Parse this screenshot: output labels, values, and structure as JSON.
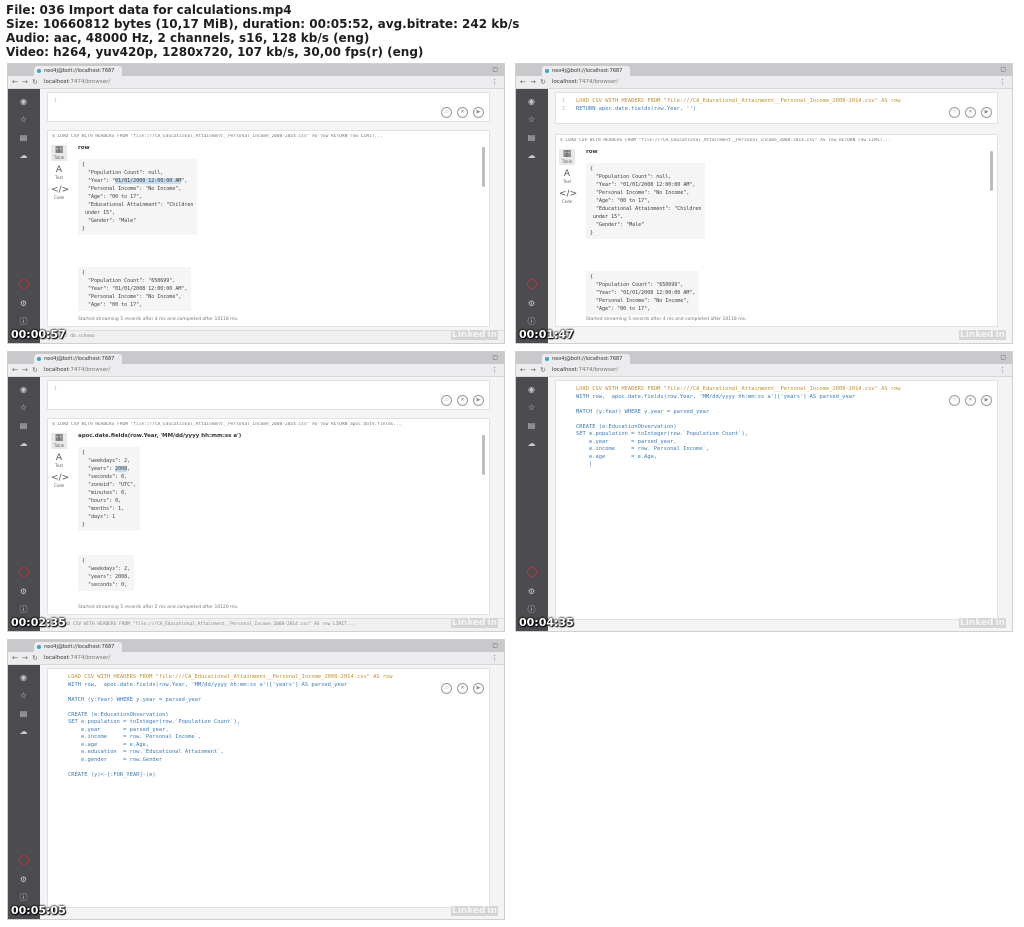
{
  "header": {
    "line1": "File: 036 Import data for calculations.mp4",
    "line2": "Size: 10660812 bytes (10,17 MiB), duration: 00:05:52, avg.bitrate: 242 kb/s",
    "line3": "Audio: aac, 48000 Hz, 2 channels, s16, 128 kb/s (eng)",
    "line4": "Video: h264, yuv420p, 1280x720, 107 kb/s, 30,00 fps(r) (eng)"
  },
  "browser": {
    "tab_title": "neo4j@bolt://localhost:7687",
    "url_host": "localhost",
    "url_path": ":7474/browser/",
    "logo_text": "Linked",
    "logo_in": "in"
  },
  "thumbs": [
    {
      "time": "00:00:57",
      "result_query": "$ LOAD CSV WITH HEADERS FROM \"file:///CA_Educational_Attainment__Personal_Income_2008-2014.csv\" AS row RETURN row LIMIT...",
      "column": "row",
      "json1_pre": "{\n  \"Population Count\": null,\n  \"Year\": \"",
      "json1_hl": "01/01/2008 12:00:00 AM",
      "json1_post": "\",\n  \"Personal Income\": \"No Income\",\n  \"Age\": \"00 to 17\",\n  \"Educational Attainment\": \"Children\n under 15\",\n  \"Gender\": \"Male\"\n}",
      "json2": "{\n  \"Population Count\": \"650699\",\n  \"Year\": \"01/01/2008 12:00:00 AM\",\n  \"Personal Income\": \"No Income\",\n  \"Age\": \"00 to 17\",",
      "status": "Started streaming 5 records after 4 ms and completed after 10118 ms.",
      "bottom": ":call db.schema"
    },
    {
      "time": "00:01:47",
      "editor_line1": "LOAD CSV WITH HEADERS FROM \"file:///CA_Educational_Attainment__Personal_Income_2008-2014.csv\" AS row",
      "editor_line2": "RETURN apoc.date.fields(row.Year, '')",
      "result_query": "$ LOAD CSV WITH HEADERS FROM \"file:///CA_Educational_Attainment__Personal_Income_2008-2014.csv\" AS row RETURN row LIMIT...",
      "column": "row",
      "json1": "{\n  \"Population Count\": null,\n  \"Year\": \"01/01/2008 12:00:00 AM\",\n  \"Personal Income\": \"No Income\",\n  \"Age\": \"00 to 17\",\n  \"Educational Attainment\": \"Children\n under 15\",\n  \"Gender\": \"Male\"\n}",
      "json2": "{\n  \"Population Count\": \"650699\",\n  \"Year\": \"01/01/2008 12:00:00 AM\",\n  \"Personal Income\": \"No Income\",\n  \"Age\": \"00 to 17\",",
      "status": "Started streaming 5 records after 4 ms and completed after 10118 ms."
    },
    {
      "time": "00:02:35",
      "result_query": "$ LOAD CSV WITH HEADERS FROM \"file:///CA_Educational_Attainment__Personal_Income_2008-2014.csv\" AS row RETURN apoc.date.fields...",
      "column": "apoc.date.fields(row.Year, 'MM/dd/yyyy hh:mm:ss a')",
      "json1_pre": "{\n  \"weekdays\": 2,\n  \"years\": ",
      "json1_hl": "2008",
      "json1_post": ",\n  \"seconds\": 0,\n  \"zoneid\": \"UTC\",\n  \"minutes\": 0,\n  \"hours\": 0,\n  \"months\": 1,\n  \"days\": 1\n}",
      "json2": "{\n  \"weekdays\": 2,\n  \"years\": 2008,\n  \"seconds\": 0,",
      "status": "Started streaming 5 records after 2 ms and completed after 10120 ms.",
      "bottom": "$ LOAD CSV WITH HEADERS FROM \"file:///CA_Educational_Attainment__Personal_Income_2008-2014.csv\" AS row LIMIT..."
    },
    {
      "time": "00:04:35",
      "code": [
        "LOAD CSV WITH HEADERS FROM \"file:///CA_Educational_Attainment__Personal_Income_2008-2014.csv\" AS row",
        "WITH row,  apoc.date.fields(row.Year, 'MM/dd/yyyy hh:mm:ss a')['years'] AS parsed_year",
        "",
        "MATCH (y:Year) WHERE y.year = parsed_year",
        "",
        "CREATE (e:EducationObservation)",
        "SET e.population = toInteger(row.`Population Count`),",
        "    e.year       = parsed_year,",
        "    e.income     = row.`Personal Income`,",
        "    e.age        = e.Age,",
        "    |"
      ]
    },
    {
      "time": "00:05:05",
      "code": [
        "LOAD CSV WITH HEADERS FROM \"file:///CA_Educational_Attainment__Personal_Income_2008-2014.csv\" AS row",
        "WITH row,  apoc.date.fields(row.Year, 'MM/dd/yyyy hh:mm:ss a')['years'] AS parsed_year",
        "",
        "MATCH (y:Year) WHERE y.year = parsed_year",
        "",
        "CREATE (e:EducationObservation)",
        "SET e.population = toInteger(row.`Population Count`),",
        "    e.year       = parsed_year,",
        "    e.income     = row.`Personal Income`,",
        "    e.age        = e.Age,",
        "    e.education  = row.`Educational Attainment`,",
        "    e.gender     = row.Gender",
        "",
        "CREATE (y)<-[:FOR_YEAR]-(e)"
      ]
    }
  ],
  "sidebar_labels": {
    "text": "Text",
    "code": "Code",
    "table": "Table"
  }
}
